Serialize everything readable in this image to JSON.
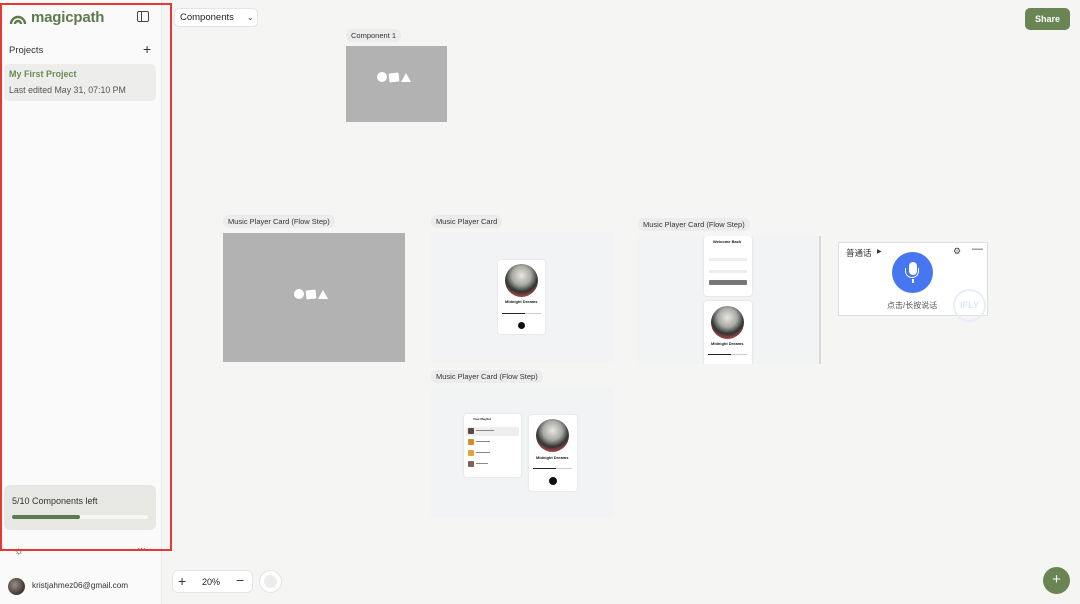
{
  "app": {
    "logo_text": "magicpath",
    "brand_color": "#5e7a4c"
  },
  "sidebar": {
    "projects_label": "Projects",
    "add_icon": "+",
    "project": {
      "name": "My First Project",
      "meta": "Last edited May 31, 07:10 PM"
    },
    "quota": {
      "text": "5/10 Components left",
      "used_fraction": 0.5
    },
    "theme_icon": "☼",
    "more_icon": "···",
    "user": {
      "email": "kristjahmez06@gmail.com"
    }
  },
  "toolbar": {
    "components_dropdown": "Components",
    "share_label": "Share"
  },
  "canvas": {
    "frames": [
      {
        "label": "Component 1"
      },
      {
        "label": "Music Player Card (Flow Step)"
      },
      {
        "label": "Music Player Card"
      },
      {
        "label": "Music Player Card (Flow Step)"
      },
      {
        "label": "Music Player Card (Flow Step)"
      }
    ],
    "card": {
      "title": "Midnight Dreams",
      "login_title": "Welcome Back",
      "signin": "Sign In",
      "playlist_title": "Your Playlist"
    }
  },
  "voice_widget": {
    "language": "普通话",
    "hint": "点击/长按说话",
    "brand": "iFLY",
    "mic_color": "#4677f0"
  },
  "zoom": {
    "plus": "+",
    "value": "20%",
    "minus": "−"
  },
  "fab": {
    "label": "+"
  }
}
